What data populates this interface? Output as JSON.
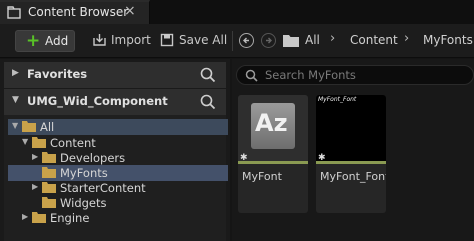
{
  "tab": {
    "title": "Content Browser",
    "close": "×"
  },
  "toolbar": {
    "add_label": "Add",
    "import_label": "Import",
    "save_all_label": "Save All"
  },
  "breadcrumb": [
    "All",
    "Content",
    "MyFonts"
  ],
  "left": {
    "favorites_label": "Favorites",
    "project_label": "UMG_Wid_Component",
    "tree": [
      {
        "label": "All"
      },
      {
        "label": "Content"
      },
      {
        "label": "Developers"
      },
      {
        "label": "MyFonts"
      },
      {
        "label": "StarterContent"
      },
      {
        "label": "Widgets"
      },
      {
        "label": "Engine"
      }
    ]
  },
  "right": {
    "search_placeholder": "Search MyFonts",
    "assets": [
      {
        "name": "MyFont",
        "thumb_text": "Az"
      },
      {
        "name": "MyFont_Font",
        "thumb_text": "MyFont_Font"
      }
    ]
  },
  "colors": {
    "add_plus": "#59c227",
    "folder": "#c9a24a",
    "selection": "#3d4a5c",
    "asset_bar": "#8a9a52"
  }
}
